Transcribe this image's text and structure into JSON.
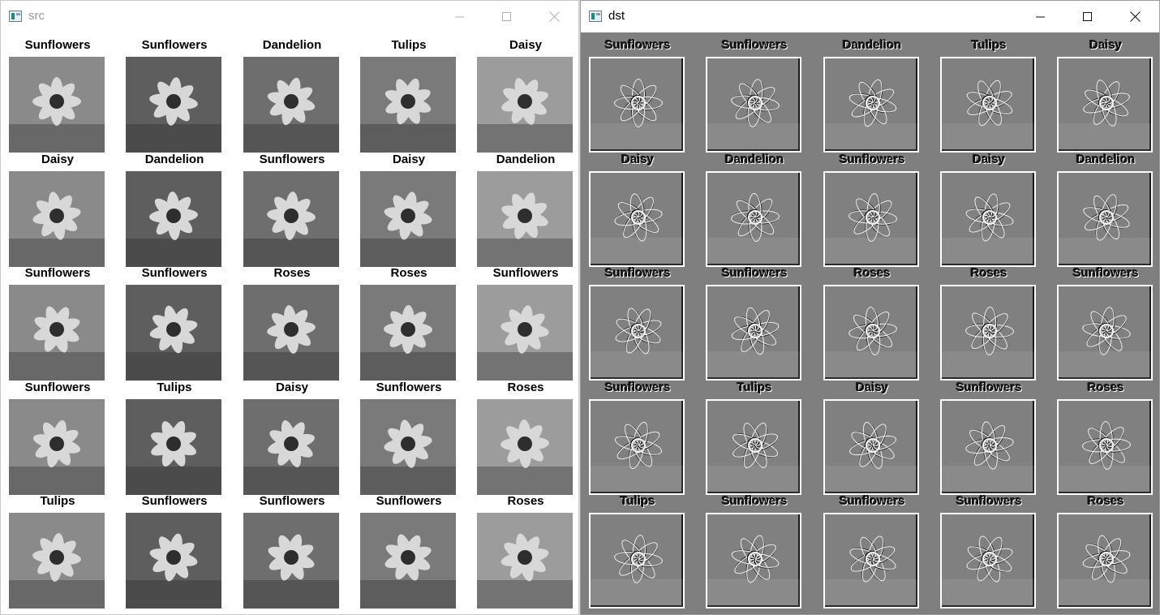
{
  "src_window": {
    "title": "src",
    "labels": [
      "Sunflowers",
      "Sunflowers",
      "Dandelion",
      "Tulips",
      "Daisy",
      "Daisy",
      "Dandelion",
      "Sunflowers",
      "Daisy",
      "Dandelion",
      "Sunflowers",
      "Sunflowers",
      "Roses",
      "Roses",
      "Sunflowers",
      "Sunflowers",
      "Tulips",
      "Daisy",
      "Sunflowers",
      "Roses",
      "Tulips",
      "Sunflowers",
      "Sunflowers",
      "Sunflowers",
      "Roses"
    ]
  },
  "dst_window": {
    "title": "dst",
    "labels": [
      "Sunflowers",
      "Sunflowers",
      "Dandelion",
      "Tulips",
      "Daisy",
      "Daisy",
      "Dandelion",
      "Sunflowers",
      "Daisy",
      "Dandelion",
      "Sunflowers",
      "Sunflowers",
      "Roses",
      "Roses",
      "Sunflowers",
      "Sunflowers",
      "Tulips",
      "Daisy",
      "Sunflowers",
      "Roses",
      "Tulips",
      "Sunflowers",
      "Sunflowers",
      "Sunflowers",
      "Roses"
    ]
  },
  "window_controls": {
    "minimize": "minimize-icon",
    "maximize": "maximize-icon",
    "close": "close-icon"
  },
  "colors": {
    "dst_background": "#7f7f7f",
    "src_background": "#ffffff"
  }
}
